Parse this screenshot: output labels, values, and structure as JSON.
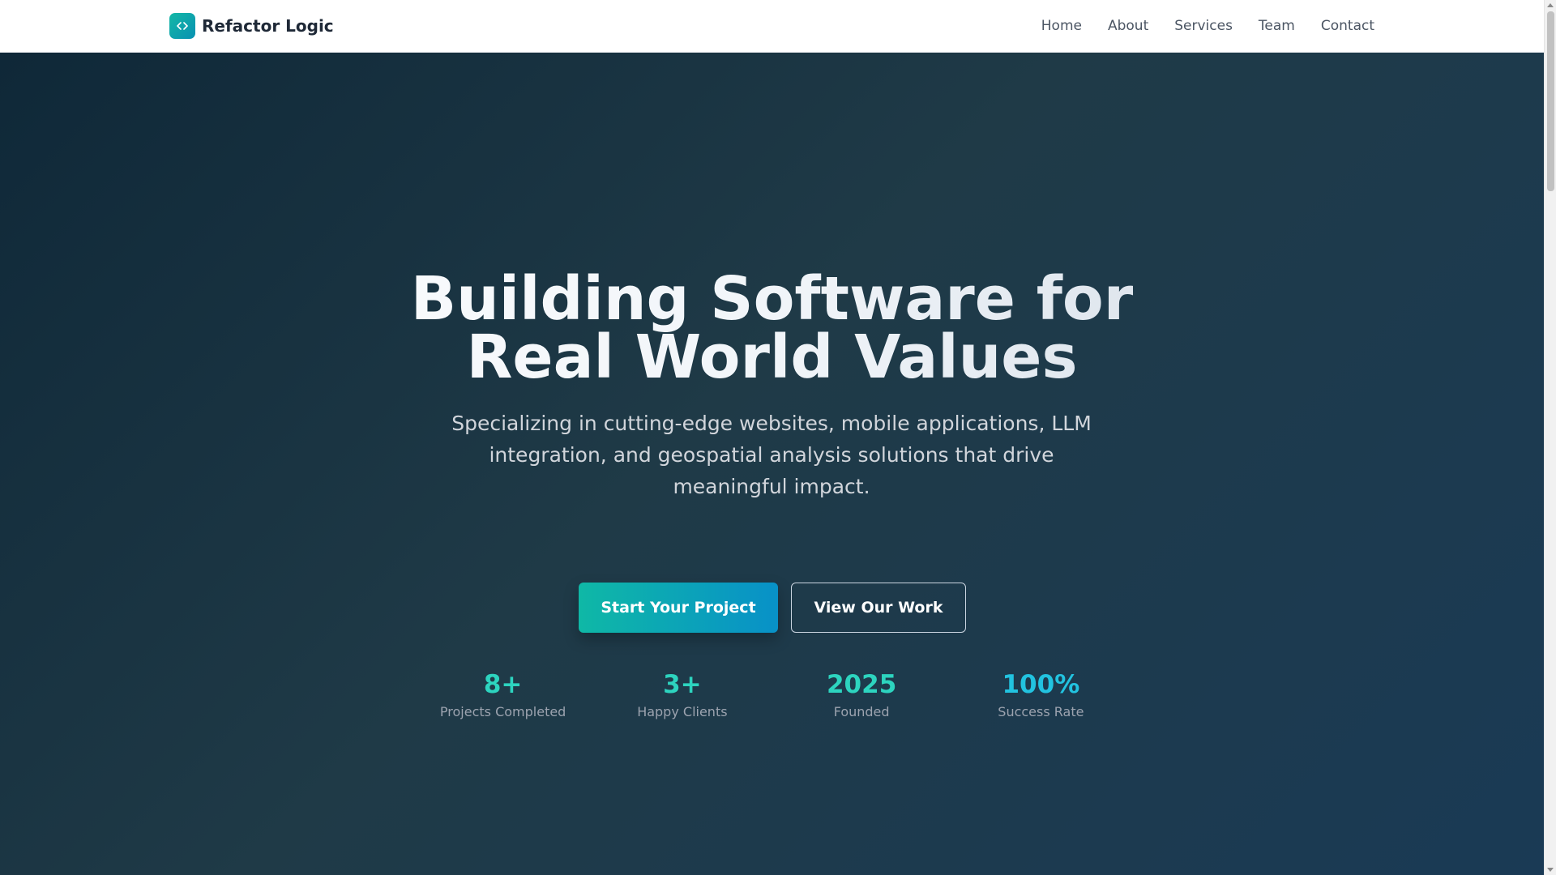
{
  "nav": {
    "brand_name": "Refactor Logic",
    "brand_icon": "code-icon",
    "links": [
      "Home",
      "About",
      "Services",
      "Team",
      "Contact"
    ]
  },
  "hero": {
    "title_line1": "Building Software for",
    "title_line2": "Real World Values",
    "subtitle": "Specializing in cutting-edge websites, mobile applications, LLM integration, and geospatial analysis solutions that drive meaningful impact.",
    "primary_button": "Start Your Project",
    "secondary_button": "View Our Work"
  },
  "stats": [
    {
      "value": "8+",
      "label": "Projects Completed"
    },
    {
      "value": "3+",
      "label": "Happy Clients"
    },
    {
      "value": "2025",
      "label": "Founded"
    },
    {
      "value": "100%",
      "label": "Success Rate"
    }
  ],
  "colors": {
    "accent": "#14b8a6",
    "accent_alt": "#0891b2",
    "hero_bg": "#1f3a47"
  }
}
